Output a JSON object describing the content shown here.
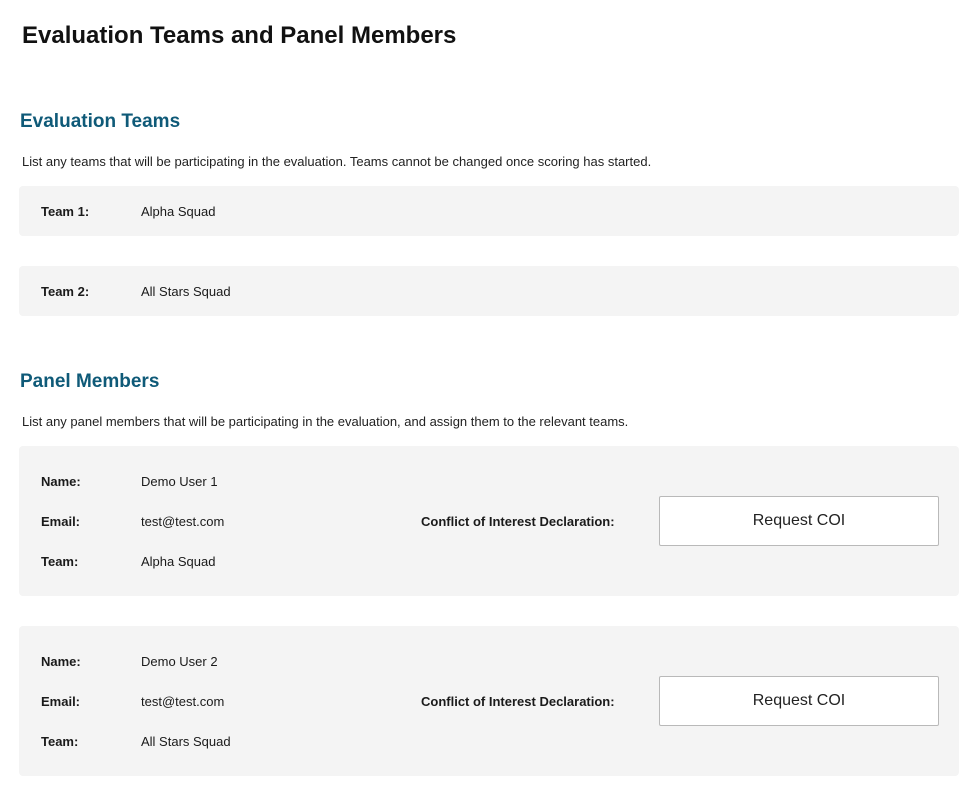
{
  "page": {
    "title": "Evaluation Teams and Panel Members"
  },
  "teams_section": {
    "title": "Evaluation Teams",
    "description": "List any teams that will be participating in the evaluation. Teams cannot be changed once scoring has started.",
    "teams": [
      {
        "label": "Team 1:",
        "name": "Alpha Squad"
      },
      {
        "label": "Team 2:",
        "name": "All Stars Squad"
      }
    ]
  },
  "panel_section": {
    "title": "Panel Members",
    "description": "List any panel members that will be participating in the evaluation, and assign them to the relevant teams.",
    "members": [
      {
        "name_label": "Name:",
        "name": "Demo User 1",
        "email_label": "Email:",
        "email": "test@test.com",
        "team_label": "Team:",
        "team": "Alpha Squad",
        "coi_label": "Conflict of Interest Declaration:",
        "coi_button": "Request COI"
      },
      {
        "name_label": "Name:",
        "name": "Demo User 2",
        "email_label": "Email:",
        "email": "test@test.com",
        "team_label": "Team:",
        "team": "All Stars Squad",
        "coi_label": "Conflict of Interest Declaration:",
        "coi_button": "Request COI"
      }
    ]
  }
}
